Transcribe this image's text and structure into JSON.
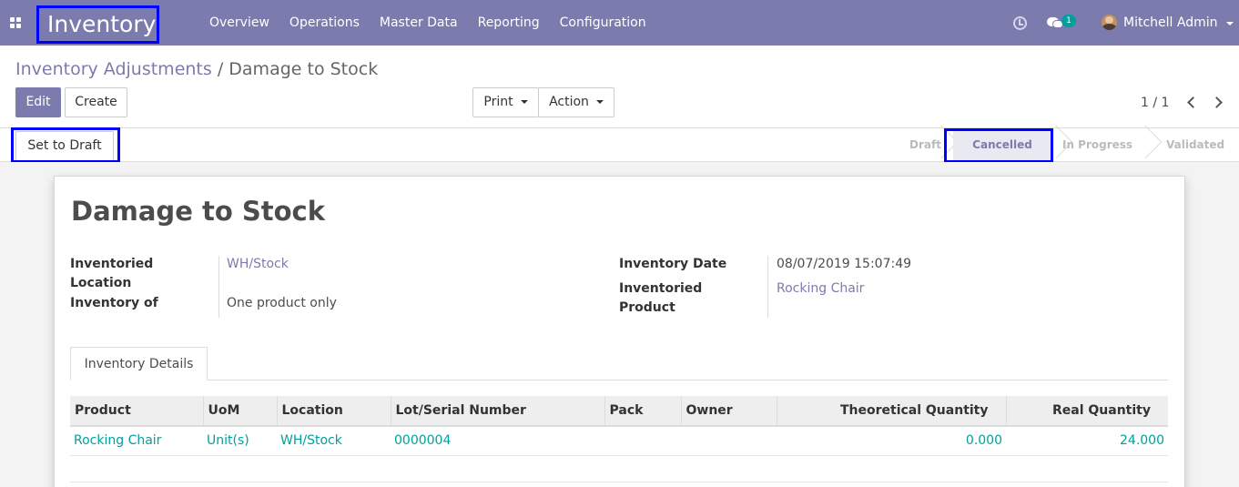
{
  "navbar": {
    "app_name": "Inventory",
    "menu": [
      "Overview",
      "Operations",
      "Master Data",
      "Reporting",
      "Configuration"
    ],
    "chat_count": "1",
    "user": "Mitchell Admin",
    "bg_color": "#7c7bad"
  },
  "breadcrumb": {
    "parent": "Inventory Adjustments",
    "separator": "/",
    "current": "Damage to Stock"
  },
  "buttons": {
    "edit": "Edit",
    "create": "Create",
    "print": "Print",
    "action": "Action",
    "set_to_draft": "Set to Draft"
  },
  "pager": "1 / 1",
  "statusbar": {
    "stages": [
      "Draft",
      "Cancelled",
      "In Progress",
      "Validated"
    ],
    "active": "Cancelled"
  },
  "record": {
    "title": "Damage to Stock",
    "inventoried_location_label": "Inventoried Location",
    "inventoried_location_line1": "Inventoried",
    "inventoried_location_line2": "Location",
    "inventoried_location": "WH/Stock",
    "inventory_of_label": "Inventory of",
    "inventory_of": "One product only",
    "inventory_date_label": "Inventory Date",
    "inventory_date": "08/07/2019 15:07:49",
    "inventoried_product_line1": "Inventoried",
    "inventoried_product_line2": "Product",
    "inventoried_product": "Rocking Chair"
  },
  "tabs": [
    "Inventory Details"
  ],
  "table": {
    "columns": [
      "Product",
      "UoM",
      "Location",
      "Lot/Serial Number",
      "Pack",
      "Owner",
      "Theoretical Quantity",
      "Real Quantity"
    ],
    "rows": [
      [
        "Rocking Chair",
        "Unit(s)",
        "WH/Stock",
        "0000004",
        "",
        "",
        "0.000",
        "24.000"
      ]
    ]
  }
}
